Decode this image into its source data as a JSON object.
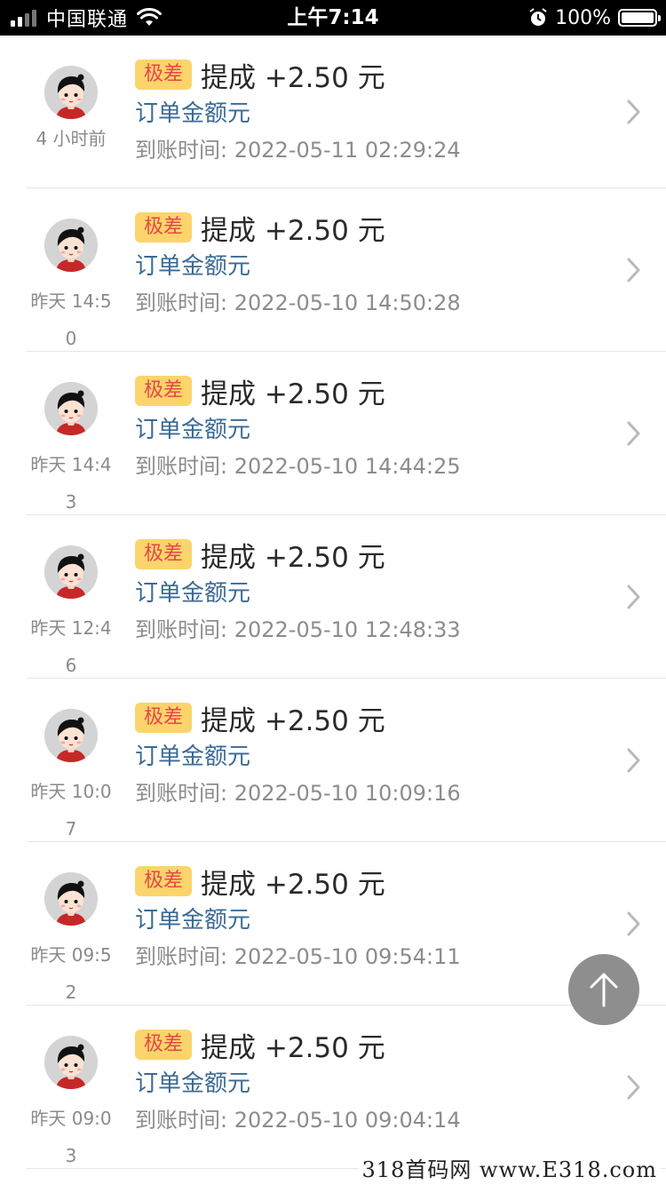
{
  "status_bar": {
    "carrier": "中国联通",
    "time": "上午7:14",
    "battery": "100%",
    "signal_bars": 2,
    "icons": [
      "signal-icon",
      "wifi-icon",
      "alarm-icon",
      "battery-icon"
    ]
  },
  "colors": {
    "badge_bg": "#fbd46b",
    "badge_text": "#e5474b",
    "subtitle": "#3a6a96",
    "fab": "#8e8e8e"
  },
  "list": [
    {
      "time": "4 小时前",
      "badge": "极差",
      "title": "提成 +2.50 元",
      "subtitle": "订单金额元",
      "arrival": "到账时间: 2022-05-11 02:29:24"
    },
    {
      "time": "昨天 14:50",
      "badge": "极差",
      "title": "提成 +2.50 元",
      "subtitle": "订单金额元",
      "arrival": "到账时间: 2022-05-10 14:50:28"
    },
    {
      "time": "昨天 14:43",
      "badge": "极差",
      "title": "提成 +2.50 元",
      "subtitle": "订单金额元",
      "arrival": "到账时间: 2022-05-10 14:44:25"
    },
    {
      "time": "昨天 12:46",
      "badge": "极差",
      "title": "提成 +2.50 元",
      "subtitle": "订单金额元",
      "arrival": "到账时间: 2022-05-10 12:48:33"
    },
    {
      "time": "昨天 10:07",
      "badge": "极差",
      "title": "提成 +2.50 元",
      "subtitle": "订单金额元",
      "arrival": "到账时间: 2022-05-10 10:09:16"
    },
    {
      "time": "昨天 09:52",
      "badge": "极差",
      "title": "提成 +2.50 元",
      "subtitle": "订单金额元",
      "arrival": "到账时间: 2022-05-10 09:54:11"
    },
    {
      "time": "昨天 09:03",
      "badge": "极差",
      "title": "提成 +2.50 元",
      "subtitle": "订单金额元",
      "arrival": "到账时间: 2022-05-10 09:04:14"
    }
  ],
  "watermark": "318首码网 www.E318.com"
}
